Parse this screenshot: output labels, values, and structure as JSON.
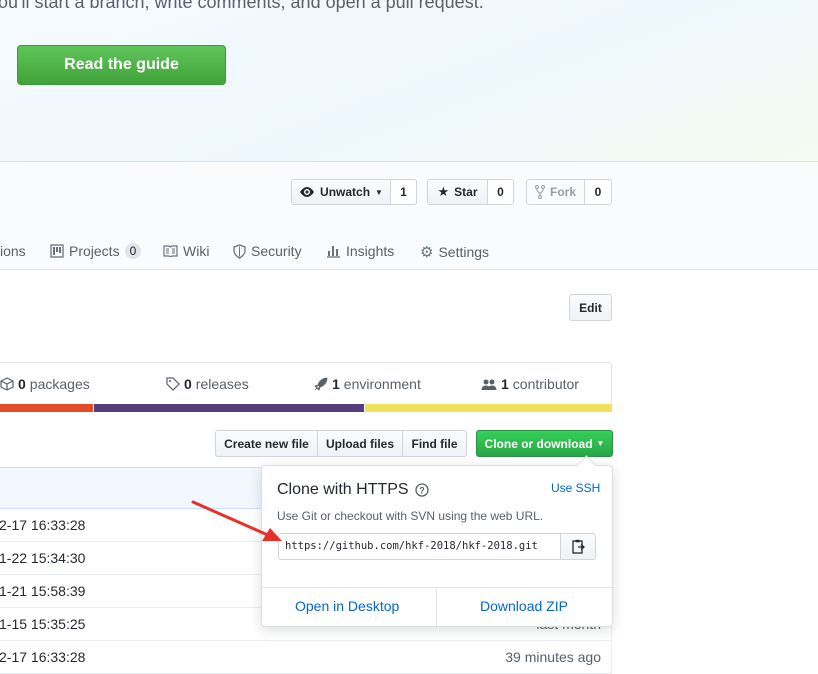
{
  "hero": {
    "text": "ou'll start a branch, write comments, and open a pull request.",
    "guide_button": "Read the guide"
  },
  "repo_actions": {
    "unwatch_label": "Unwatch",
    "watch_count": "1",
    "star_label": "Star",
    "star_count": "0",
    "fork_label": "Fork",
    "fork_count": "0"
  },
  "tabs": [
    {
      "label": "ions"
    },
    {
      "label": "Projects",
      "counter": "0"
    },
    {
      "label": "Wiki"
    },
    {
      "label": "Security"
    },
    {
      "label": "Insights"
    },
    {
      "label": "Settings"
    }
  ],
  "edit_button": "Edit",
  "summary": {
    "packages_count": "0",
    "packages_label": "packages",
    "releases_count": "0",
    "releases_label": "releases",
    "environment_count": "1",
    "environment_label": "environment",
    "contributor_count": "1",
    "contributor_label": "contributor"
  },
  "language_colors": [
    "#e34c26",
    "#563d7c",
    "#f1e05a"
  ],
  "language_shares": [
    0.25,
    0.44,
    0.407
  ],
  "file_buttons": {
    "create": "Create new file",
    "upload": "Upload files",
    "find": "Find file",
    "clone": "Clone or download"
  },
  "rows": [
    {
      "date": "2-17 16:33:28",
      "ago": ""
    },
    {
      "date": "1-22 15:34:30",
      "ago": ""
    },
    {
      "date": "1-21 15:58:39",
      "ago": ""
    },
    {
      "date": "1-15 15:35:25",
      "ago": "last month"
    },
    {
      "date": "2-17 16:33:28",
      "ago": "39 minutes ago"
    }
  ],
  "clone_popover": {
    "title": "Clone with HTTPS",
    "use_ssh": "Use SSH",
    "description": "Use Git or checkout with SVN using the web URL.",
    "url": "https://github.com/hkf-2018/hkf-2018.git",
    "open_desktop": "Open in Desktop",
    "download_zip": "Download ZIP"
  },
  "colors": {
    "green": "#28a745",
    "link": "#0366d6",
    "arrow": "#e8302a"
  }
}
